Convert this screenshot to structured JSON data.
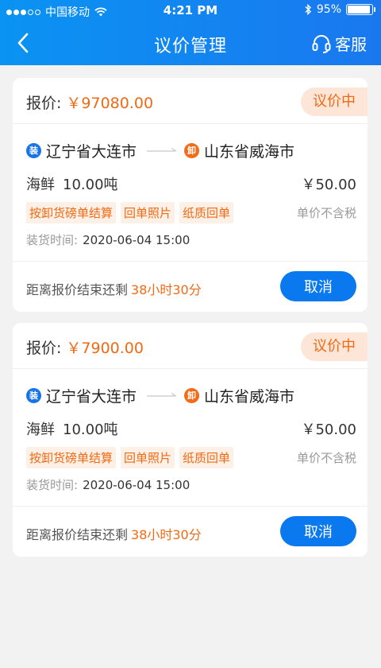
{
  "status_bar": {
    "carrier": "中国移动",
    "time": "4:21 PM",
    "battery": "95%",
    "battery_level": 0.95
  },
  "navbar": {
    "title": "议价管理",
    "service_label": "客服"
  },
  "labels": {
    "price_prefix": "报价:",
    "load_tag": "装",
    "unload_tag": "卸",
    "load_time_prefix": "装货时间:",
    "remaining_prefix": "距离报价结束还剩",
    "cancel": "取消",
    "tax_note": "单价不含税"
  },
  "cards": [
    {
      "price": "￥97080.00",
      "status": "议价中",
      "origin": "辽宁省大连市",
      "destination": "山东省威海市",
      "cargo": "海鲜",
      "weight": "10.00吨",
      "unit_price": "￥50.00",
      "tags": [
        "按卸货磅单结算",
        "回单照片",
        "纸质回单"
      ],
      "load_time": "2020-06-04 15:00",
      "remaining": "38小时30分"
    },
    {
      "price": "￥7900.00",
      "status": "议价中",
      "origin": "辽宁省大连市",
      "destination": "山东省威海市",
      "cargo": "海鲜",
      "weight": "10.00吨",
      "unit_price": "￥50.00",
      "tags": [
        "按卸货磅单结算",
        "回单照片",
        "纸质回单"
      ],
      "load_time": "2020-06-04 15:00",
      "remaining": "38小时30分"
    }
  ]
}
